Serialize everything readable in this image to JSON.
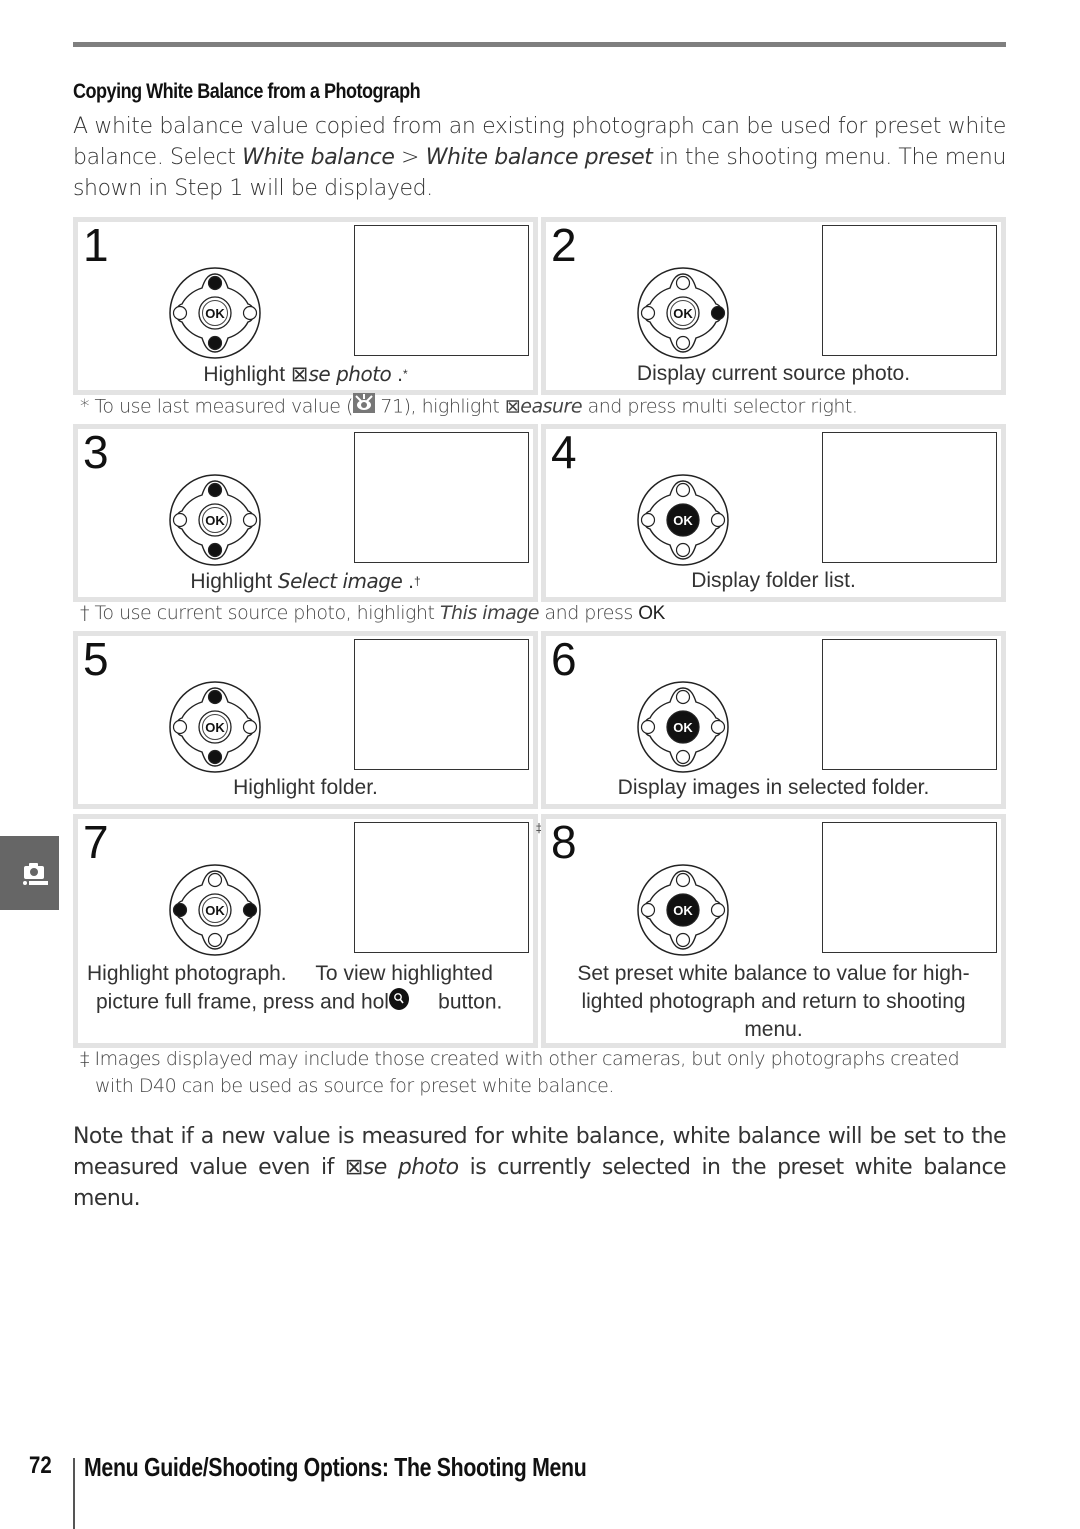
{
  "section": {
    "title": "Copying White Balance from a Photograph",
    "intro": {
      "part1": "A white balance value copied from an existing photograph can be used for preset white balance.  Select ",
      "menu1": "White balance",
      "sep": "  > ",
      "menu2": "White balance preset",
      "part2": "   in the shooting menu.  The menu shown in Step 1 will be displayed."
    }
  },
  "steps": [
    {
      "num": "1",
      "caption_pre": "Highlight ",
      "caption_glyph": "⊠",
      "caption_italic": "se photo",
      "caption_post": "   .",
      "mark": "*",
      "dpad": {
        "up": true,
        "down": true,
        "left": false,
        "right": false,
        "ok_pressed": false
      }
    },
    {
      "num": "2",
      "caption_pre": "Display current source photo.",
      "dpad": {
        "up": false,
        "down": false,
        "left": false,
        "right": true,
        "ok_pressed": false
      }
    },
    {
      "num": "3",
      "caption_pre": "Highlight ",
      "caption_italic": "Select image",
      "caption_post": "   .",
      "mark": "†",
      "dpad": {
        "up": true,
        "down": true,
        "left": false,
        "right": false,
        "ok_pressed": false
      }
    },
    {
      "num": "4",
      "caption_pre": "Display folder list.",
      "dpad": {
        "up": false,
        "down": false,
        "left": false,
        "right": false,
        "ok_pressed": true
      }
    },
    {
      "num": "5",
      "caption_pre": "Highlight folder.",
      "dpad": {
        "up": true,
        "down": true,
        "left": false,
        "right": false,
        "ok_pressed": false
      }
    },
    {
      "num": "6",
      "caption_pre": "Display images in selected folder.",
      "dpad": {
        "up": false,
        "down": false,
        "left": false,
        "right": false,
        "ok_pressed": true
      }
    },
    {
      "num": "7",
      "mark": "‡",
      "caption_line1": "Highlight photograph.     To view highlighted",
      "caption_line2_pre": "picture full frame, press and hol",
      "caption_line2_post": "     button.",
      "button_icon": "zoom-button-icon",
      "dpad": {
        "up": false,
        "down": false,
        "left": true,
        "right": true,
        "ok_pressed": false
      }
    },
    {
      "num": "8",
      "caption_line1": "Set preset white balance to value for high-",
      "caption_line2": "lighted photograph and return to shooting",
      "caption_line3": "menu.",
      "dpad": {
        "up": false,
        "down": false,
        "left": false,
        "right": false,
        "ok_pressed": true
      }
    }
  ],
  "footnotes": {
    "star": {
      "pre": "* To use last measured value (",
      "icon": "page-reference-icon",
      "page": " 71), highlight ",
      "glyph": "⊠",
      "italic": "easure",
      "post": "     and press multi selector right."
    },
    "dagger": {
      "pre": "† To use current source photo, highlight ",
      "italic": "This image",
      "post": "    and press ",
      "ok": "OK"
    },
    "ddagger": {
      "line1": "‡ Images displayed may include those created with other cameras, but only photographs created",
      "line2": "with D40 can be used as source for preset white balance."
    }
  },
  "note": {
    "pre": "Note that if a new value is measured for white balance, white balance will be set to the measured value even if ",
    "glyph": "⊠",
    "italic": "se photo",
    "post": "    is currently selected in the preset white balance menu."
  },
  "dpad_ok_label": "OK",
  "side_tab": {
    "icon": "camera-icon",
    "color": "#666666"
  },
  "footer": {
    "page_number": "72",
    "title": "Menu Guide/Shooting Options: The Shooting Menu"
  }
}
